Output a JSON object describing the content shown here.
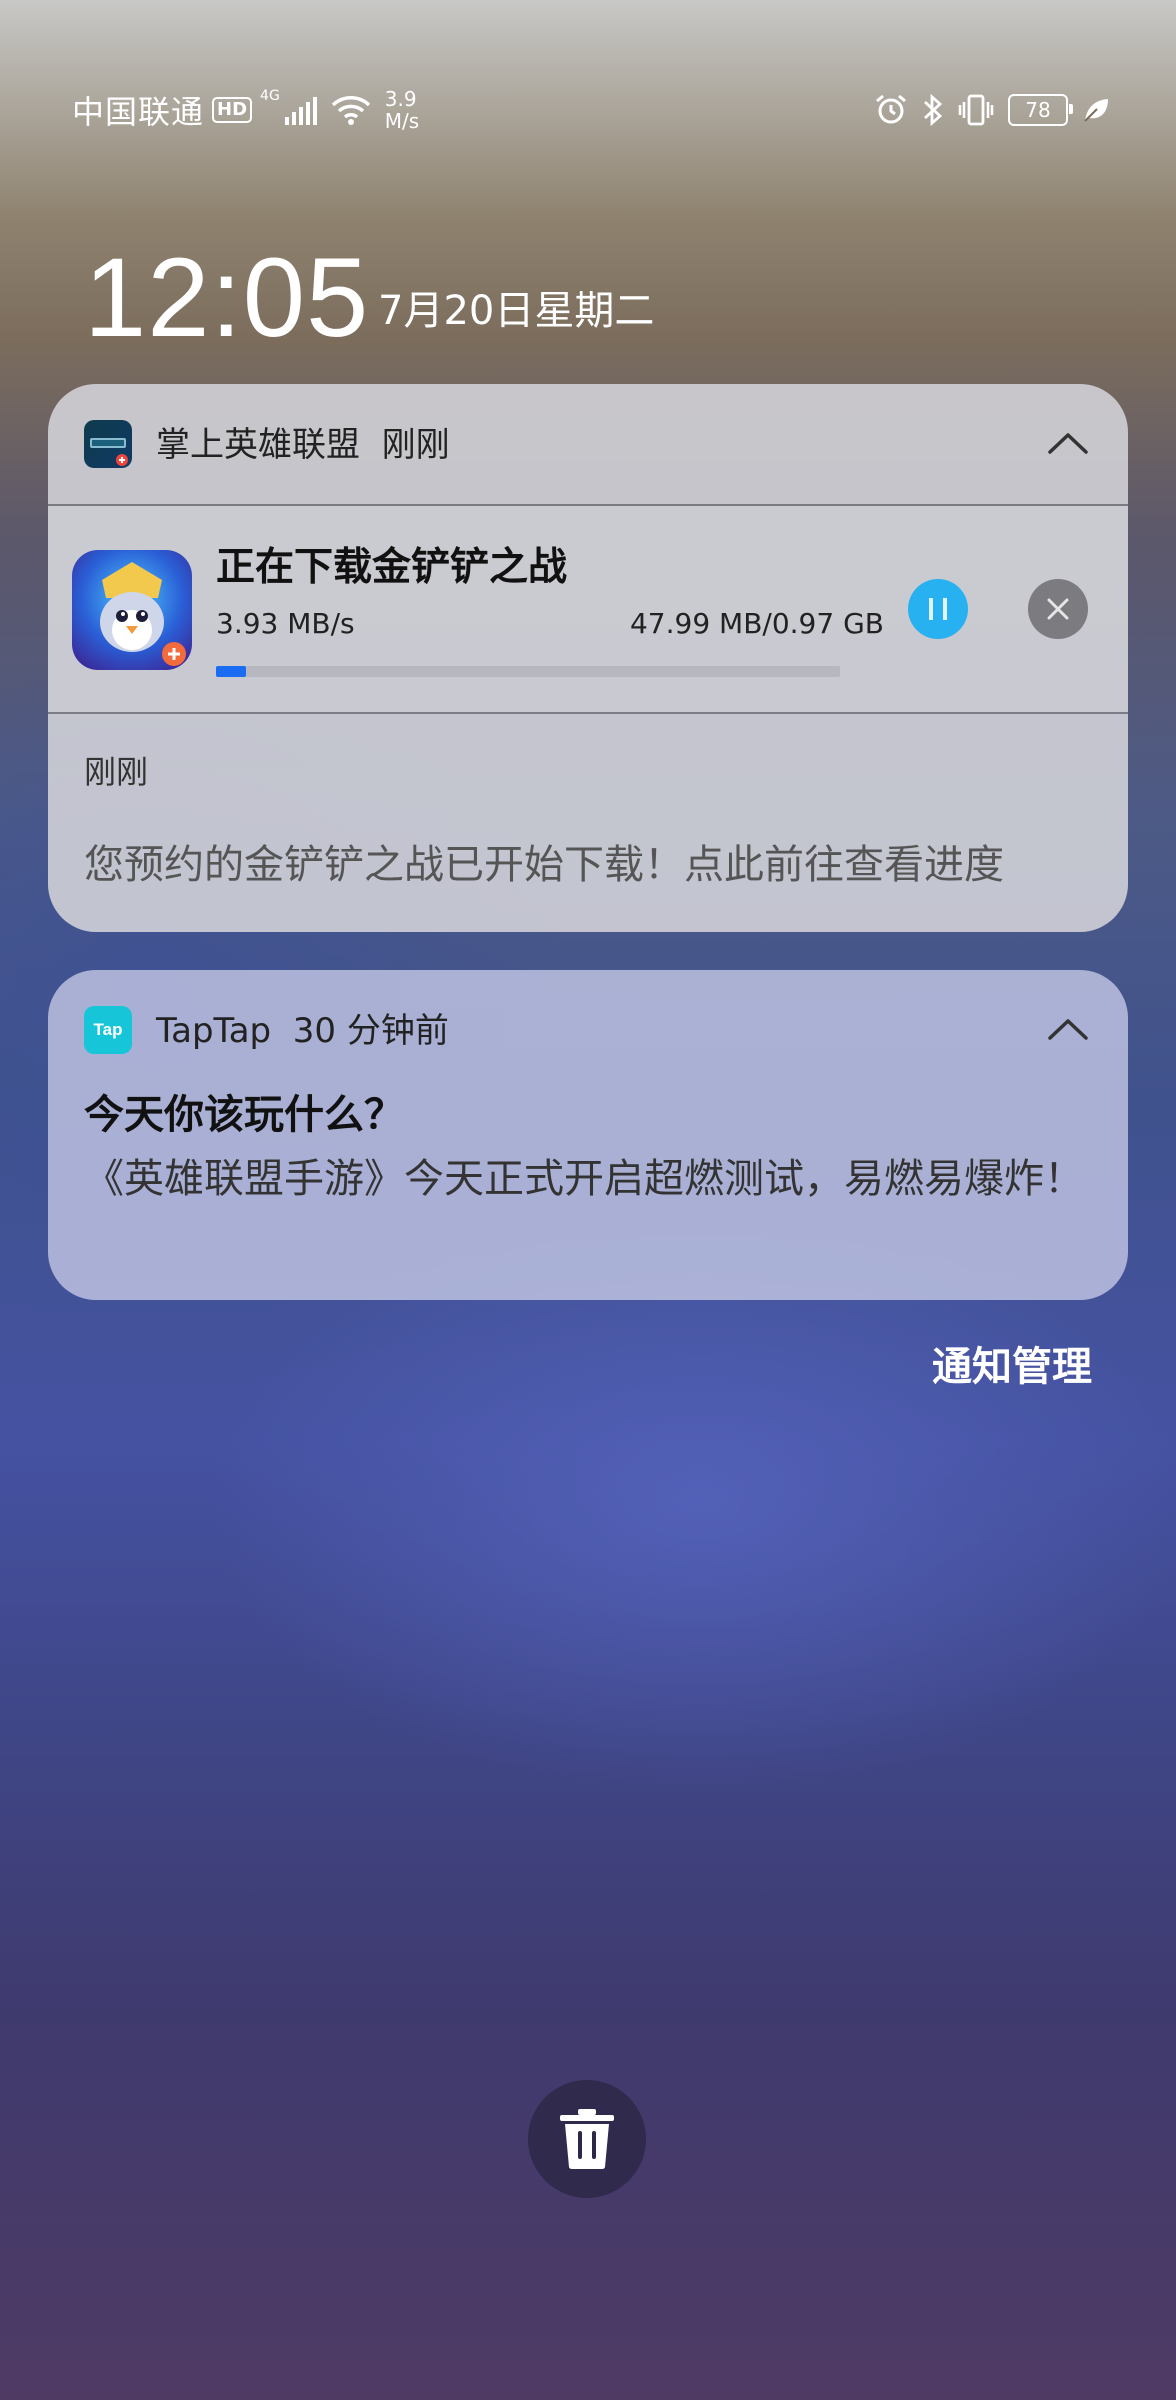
{
  "status_bar": {
    "carrier": "中国联通",
    "hd_badge": "HD",
    "network_type": "4G",
    "net_speed_value": "3.9",
    "net_speed_unit": "M/s",
    "battery": "78",
    "icons": [
      "alarm-icon",
      "bluetooth-icon",
      "vibrate-icon",
      "battery-icon",
      "eco-leaf-icon"
    ]
  },
  "lockscreen": {
    "time": "12:05",
    "date": "7月20日星期二"
  },
  "notifications": [
    {
      "app_name": "掌上英雄联盟",
      "time": "刚刚",
      "download": {
        "title": "正在下载金铲铲之战",
        "speed": "3.93 MB/s",
        "size": "47.99 MB/0.97 GB",
        "progress": 0.048
      },
      "sub_time": "刚刚",
      "body": "您预约的金铲铲之战已开始下载！点此前往查看进度"
    },
    {
      "app_name": "TapTap",
      "app_icon_text": "Tap",
      "time": "30 分钟前",
      "title": "今天你该玩什么？",
      "body": "《英雄联盟手游》今天正式开启超燃测试，易燃易爆炸！"
    }
  ],
  "manage_label": "通知管理",
  "colors": {
    "accent_blue": "#1a6df2",
    "pause_button": "#27b1f0",
    "taptap_brand": "#16c6d8"
  }
}
